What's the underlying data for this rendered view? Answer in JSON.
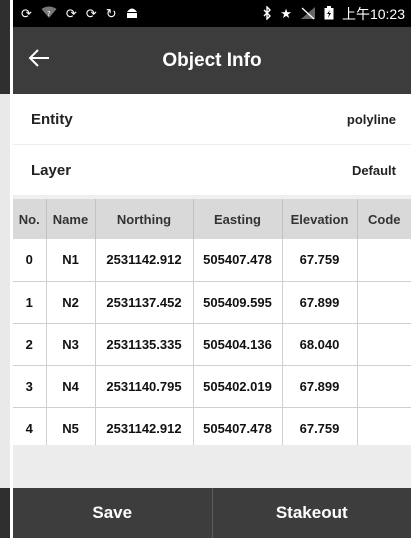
{
  "status_bar": {
    "time": "上午10:23"
  },
  "header": {
    "title": "Object Info"
  },
  "info": [
    {
      "label": "Entity",
      "value": "polyline"
    },
    {
      "label": "Layer",
      "value": "Default"
    }
  ],
  "table": {
    "columns": [
      "No.",
      "Name",
      "Northing",
      "Easting",
      "Elevation",
      "Code"
    ],
    "rows": [
      [
        "0",
        "N1",
        "2531142.912",
        "505407.478",
        "67.759",
        ""
      ],
      [
        "1",
        "N2",
        "2531137.452",
        "505409.595",
        "67.899",
        ""
      ],
      [
        "2",
        "N3",
        "2531135.335",
        "505404.136",
        "68.040",
        ""
      ],
      [
        "3",
        "N4",
        "2531140.795",
        "505402.019",
        "67.899",
        ""
      ],
      [
        "4",
        "N5",
        "2531142.912",
        "505407.478",
        "67.759",
        ""
      ]
    ]
  },
  "buttons": {
    "save": "Save",
    "stakeout": "Stakeout"
  },
  "colors": {
    "statusbar": "#000000",
    "appbar": "#3c3c3c",
    "table_header": "#d9d9d9",
    "bottom_bar": "#3d3d3d"
  },
  "icons": {
    "status_left": [
      "sync-icon",
      "wifi-question-icon",
      "sync-icon",
      "sync-icon",
      "refresh-icon",
      "android-icon"
    ],
    "status_right": [
      "bluetooth-icon",
      "star-icon",
      "signal-icon",
      "battery-icon"
    ],
    "back": "arrow-left-icon"
  }
}
